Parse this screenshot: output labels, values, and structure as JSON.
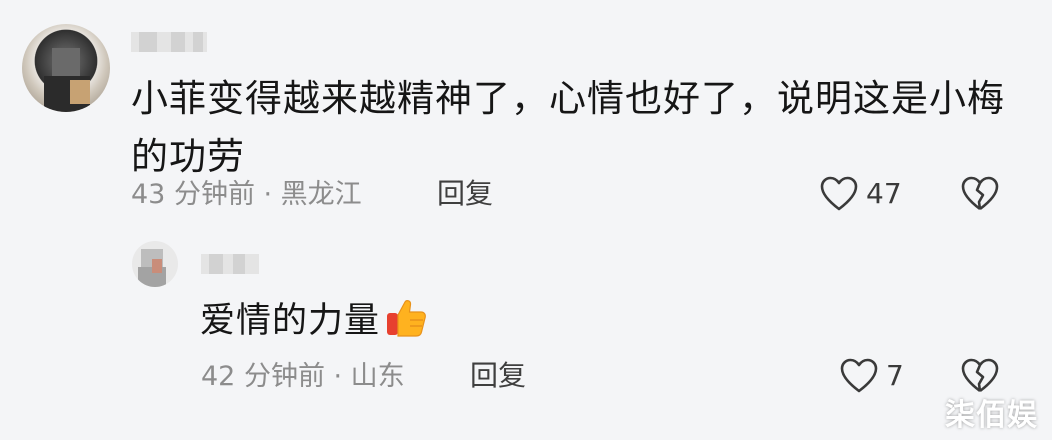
{
  "comments": [
    {
      "text": "小菲变得越来越精神了，心情也好了，说明这是小梅的功劳",
      "meta": "43 分钟前 · 黑龙江",
      "reply_label": "回复",
      "like_count": "47"
    }
  ],
  "reply": {
    "text": "爱情的力量",
    "emoji": "thumbs-up",
    "meta": "42 分钟前 · 山东",
    "reply_label": "回复",
    "like_count": "7"
  },
  "watermark": "柒佰娱",
  "colors": {
    "background": "#f4f5f7",
    "text": "#161616",
    "meta": "#8c8c8c",
    "icon": "#3a3a3a"
  }
}
